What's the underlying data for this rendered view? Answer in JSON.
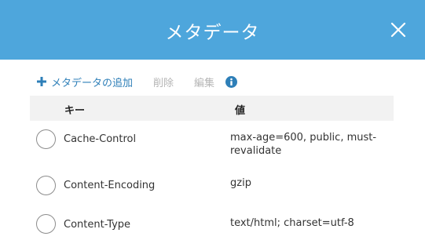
{
  "dialog": {
    "title": "メタデータ",
    "close_icon": "close-icon"
  },
  "toolbar": {
    "add_label": "メタデータの追加",
    "delete_label": "削除",
    "edit_label": "編集",
    "info_icon": "info-icon",
    "plus_icon": "plus-icon"
  },
  "table": {
    "headers": {
      "key": "キー",
      "value": "値"
    },
    "rows": [
      {
        "key": "Cache-Control",
        "value": "max-age=600, public, must-revalidate"
      },
      {
        "key": "Content-Encoding",
        "value": "gzip"
      },
      {
        "key": "Content-Type",
        "value": "text/html; charset=utf-8"
      }
    ]
  },
  "colors": {
    "header_bg": "#4ea6dc",
    "accent": "#2e7fb8",
    "disabled": "#b5b5b5",
    "table_header_bg": "#f2f2f2"
  }
}
